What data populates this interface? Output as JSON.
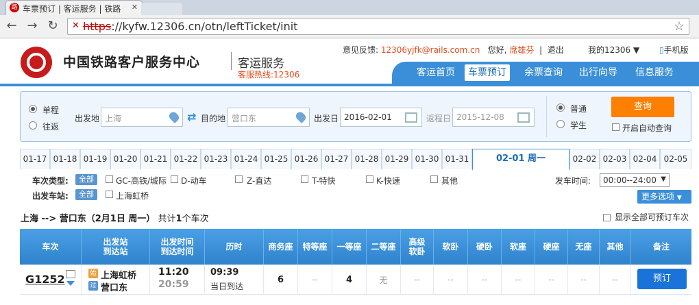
{
  "browser": {
    "tab_title": "车票预订 | 客运服务 | 铁路",
    "url_scheme": "https",
    "url_rest": "://kyfw.12306.cn/otn/leftTicket/init"
  },
  "header": {
    "site_name": "中国铁路客户服务中心",
    "service": "客运服务",
    "hotline": "客服热线:12306",
    "feedback_label": "意见反馈:",
    "feedback_email": "12306yjfk@rails.com.cn",
    "greeting": "您好,",
    "username": "席雄芬",
    "logout": "退出",
    "my12306": "我的12306",
    "mobile": "手机版",
    "nav": [
      "客运首页",
      "车票预订",
      "余票查询",
      "出行向导",
      "信息服务"
    ]
  },
  "form": {
    "oneway": "单程",
    "roundtrip": "往返",
    "from_label": "出发地",
    "from_value": "上海",
    "to_label": "目的地",
    "to_value": "营口东",
    "date_label": "出发日",
    "date_value": "2016-02-01",
    "return_label": "返程日",
    "return_value": "2015-12-08",
    "normal": "普通",
    "student": "学生",
    "query_button": "查询",
    "auto_query": "开启自动查询"
  },
  "dates": [
    "01-17",
    "01-18",
    "01-19",
    "01-20",
    "01-21",
    "01-22",
    "01-23",
    "01-24",
    "01-25",
    "01-26",
    "01-27",
    "01-28",
    "01-29",
    "01-30",
    "01-31",
    "02-01 周一",
    "02-02",
    "02-03",
    "02-04",
    "02-05"
  ],
  "filters": {
    "type_label": "车次类型:",
    "all": "全部",
    "types": [
      "GC-高铁/城际",
      "D-动车",
      "Z-直达",
      "T-特快",
      "K-快速",
      "其他"
    ],
    "station_label": "出发车站:",
    "stations": [
      "上海虹桥"
    ],
    "depart_time_label": "发车时间:",
    "depart_time_value": "00:00--24:00",
    "more": "更多选项"
  },
  "summary": {
    "route": "上海 --> 营口东（2月1日  周一）",
    "count_pre": "共计",
    "count": "1",
    "count_post": "个车次",
    "show_all": "显示全部可预订车次"
  },
  "table": {
    "headers": [
      "车次",
      "出发站\n到达站",
      "出发时间\n到达时间",
      "历时",
      "商务座",
      "特等座",
      "一等座",
      "二等座",
      "高级\n软卧",
      "软卧",
      "硬卧",
      "软座",
      "硬座",
      "无座",
      "其他",
      "备注"
    ],
    "row": {
      "train": "G1252",
      "from_badge": "始",
      "from_station": "上海虹桥",
      "to_badge": "过",
      "to_station": "营口东",
      "depart": "11:20",
      "arrive": "20:59",
      "duration": "09:39",
      "arrival_day": "当日到达",
      "seats": [
        "6",
        "--",
        "4",
        "无",
        "--",
        "--",
        "--",
        "--",
        "--",
        "--",
        "--"
      ],
      "book": "预订"
    }
  },
  "colors": {
    "brand_blue": "#3a8fd8",
    "accent_orange": "#ff7f00",
    "brand_red": "#c81a1a"
  }
}
